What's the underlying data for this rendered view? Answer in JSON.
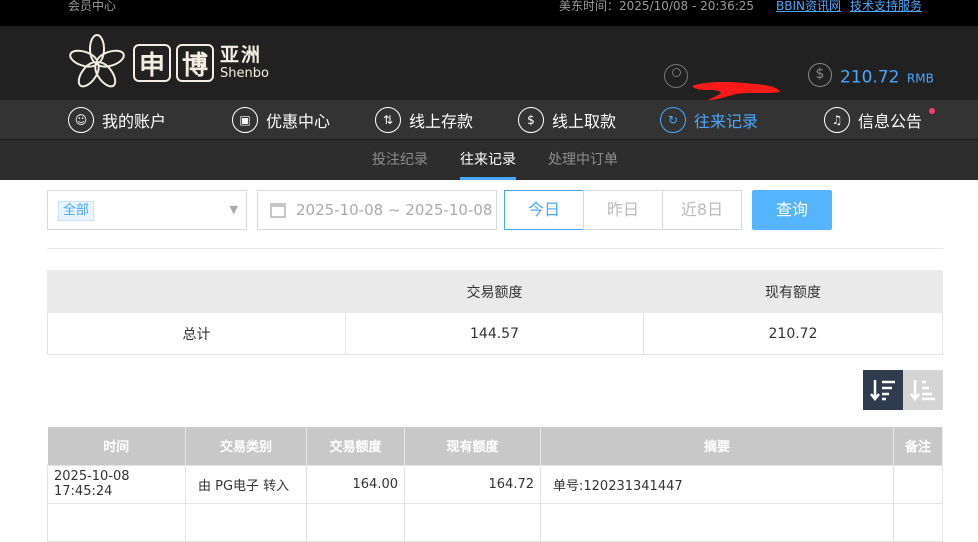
{
  "topbar": {
    "member_center": "会员中心",
    "time_label": "美东时间：2025/10/08 - 20:36:25",
    "links": [
      "BBIN资讯网",
      "技术支持服务"
    ]
  },
  "header": {
    "logo_chars": [
      "申",
      "博"
    ],
    "logo_cn": "亚洲",
    "logo_en": "Shenbo",
    "balance_amount": "210.72",
    "balance_currency": "RMB"
  },
  "nav": {
    "items": [
      {
        "label": "我的账户",
        "icon": "user-icon"
      },
      {
        "label": "优惠中心",
        "icon": "gift-icon"
      },
      {
        "label": "线上存款",
        "icon": "deposit-icon"
      },
      {
        "label": "线上取款",
        "icon": "withdraw-icon"
      },
      {
        "label": "往来记录",
        "icon": "records-icon",
        "active": true
      },
      {
        "label": "信息公告",
        "icon": "bell-icon"
      }
    ]
  },
  "subnav": {
    "items": [
      {
        "label": "投注纪录"
      },
      {
        "label": "往来记录",
        "active": true
      },
      {
        "label": "处理中订单"
      }
    ]
  },
  "filters": {
    "type_selected": "全部",
    "date_range": "2025-10-08 ~ 2025-10-08",
    "quick_dates": [
      "今日",
      "昨日",
      "近8日"
    ],
    "active_quick": "今日",
    "query_label": "查询"
  },
  "summary": {
    "headers": [
      "",
      "交易额度",
      "现有额度"
    ],
    "row": [
      "总计",
      "144.57",
      "210.72"
    ]
  },
  "records": {
    "headers": [
      "时间",
      "交易类别",
      "交易额度",
      "现有额度",
      "摘要",
      "备注"
    ],
    "rows": [
      [
        "2025-10-08 17:45:24",
        "由 PG电子 转入",
        "164.00",
        "164.72",
        "单号:120231341447",
        ""
      ]
    ]
  },
  "colors": {
    "accent": "#4aa7ff",
    "header_bg": "#212121",
    "nav_bg": "#333333",
    "notification_dot": "#ff3d6b"
  }
}
